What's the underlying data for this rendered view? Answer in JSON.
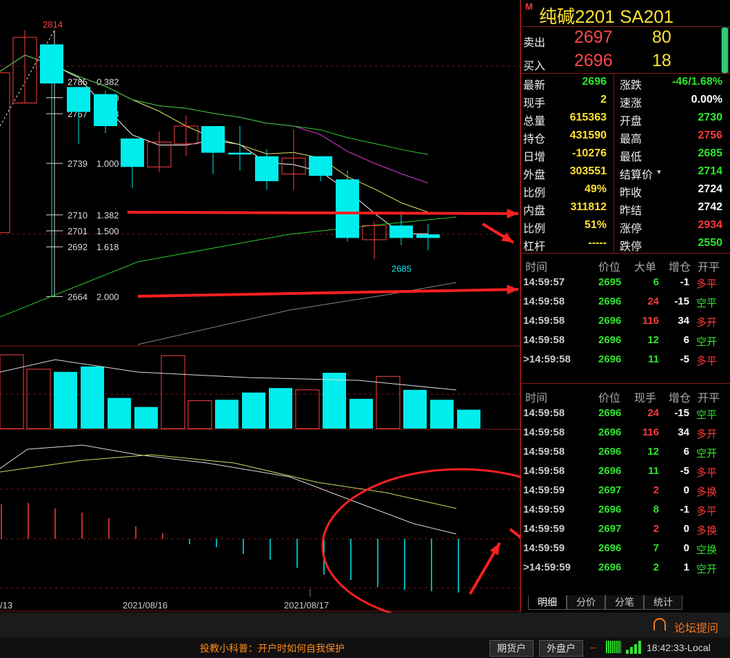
{
  "chart_data": {
    "type": "candlestick",
    "candles": [
      {
        "o": 2700,
        "h": 2792,
        "l": 2700,
        "c": 2790
      },
      {
        "o": 2773,
        "h": 2814,
        "l": 2773,
        "c": 2810
      },
      {
        "o": 2806,
        "h": 2806,
        "l": 2664,
        "c": 2784
      },
      {
        "o": 2782,
        "h": 2782,
        "l": 2750,
        "c": 2768
      },
      {
        "o": 2778,
        "h": 2780,
        "l": 2756,
        "c": 2760
      },
      {
        "o": 2753,
        "h": 2753,
        "l": 2725,
        "c": 2737
      },
      {
        "o": 2737,
        "h": 2757,
        "l": 2734,
        "c": 2751
      },
      {
        "o": 2750,
        "h": 2766,
        "l": 2743,
        "c": 2760
      },
      {
        "o": 2760,
        "h": 2760,
        "l": 2733,
        "c": 2745
      },
      {
        "o": 2745,
        "h": 2760,
        "l": 2735,
        "c": 2744
      },
      {
        "o": 2743,
        "h": 2747,
        "l": 2724,
        "c": 2729
      },
      {
        "o": 2733,
        "h": 2758,
        "l": 2724,
        "c": 2742
      },
      {
        "o": 2743,
        "h": 2743,
        "l": 2729,
        "c": 2732
      },
      {
        "o": 2730,
        "h": 2735,
        "l": 2695,
        "c": 2697
      },
      {
        "o": 2696,
        "h": 2706,
        "l": 2685,
        "c": 2704
      },
      {
        "o": 2704,
        "h": 2712,
        "l": 2693,
        "c": 2697
      },
      {
        "o": 2699,
        "h": 2705,
        "l": 2690,
        "c": 2697
      }
    ],
    "ylim": [
      2637,
      2831
    ],
    "price_labels": {
      "high": "2814",
      "low": "2685"
    },
    "fib_levels": [
      {
        "price": "2785",
        "ratio": "0.382"
      },
      {
        "price": "2776",
        "ratio": "0.500"
      },
      {
        "price": "2767",
        "ratio": "0.618"
      },
      {
        "price": "2739",
        "ratio": "1.000"
      },
      {
        "price": "2710",
        "ratio": "1.382"
      },
      {
        "price": "2701",
        "ratio": "1.500"
      },
      {
        "price": "2692",
        "ratio": "1.618"
      },
      {
        "price": "2664",
        "ratio": "2.000"
      }
    ],
    "volume": [
      82,
      66,
      63,
      69,
      34,
      24,
      81,
      31,
      32,
      40,
      45,
      43,
      62,
      33,
      58,
      43,
      32,
      21
    ],
    "dates": [
      "/13",
      "2021/08/16",
      "2021/08/17"
    ]
  },
  "quote": {
    "m": "M",
    "title": "纯碱2201  SA201",
    "sell_label": "卖出",
    "sell_price": "2697",
    "sell_vol": "80",
    "buy_label": "买入",
    "buy_price": "2696",
    "buy_vol": "18",
    "stats": [
      {
        "l1": "最新",
        "v1": "2696",
        "c1": "grn",
        "l2": "涨跌",
        "v2": "-46/1.68%",
        "c2": "grn"
      },
      {
        "l1": "现手",
        "v1": "2",
        "c1": "yel",
        "l2": "速涨",
        "v2": "0.00%",
        "c2": "wht"
      },
      {
        "l1": "总量",
        "v1": "615363",
        "c1": "yel",
        "l2": "开盘",
        "v2": "2730",
        "c2": "grn"
      },
      {
        "l1": "持仓",
        "v1": "431590",
        "c1": "yel",
        "l2": "最高",
        "v2": "2756",
        "c2": "red"
      },
      {
        "l1": "日增",
        "v1": "-10276",
        "c1": "yel",
        "l2": "最低",
        "v2": "2685",
        "c2": "grn"
      },
      {
        "l1": "外盘",
        "v1": "303551",
        "c1": "yel",
        "l2": "结算价",
        "v2": "2714",
        "c2": "grn"
      },
      {
        "l1": "比例",
        "v1": "49%",
        "c1": "yel",
        "l2": "昨收",
        "v2": "2724",
        "c2": "wht"
      },
      {
        "l1": "内盘",
        "v1": "311812",
        "c1": "yel",
        "l2": "昨结",
        "v2": "2742",
        "c2": "wht"
      },
      {
        "l1": "比例",
        "v1": "51%",
        "c1": "yel",
        "l2": "涨停",
        "v2": "2934",
        "c2": "red"
      },
      {
        "l1": "杠杆",
        "v1": "-----",
        "c1": "yel",
        "l2": "跌停",
        "v2": "2550",
        "c2": "grn"
      }
    ]
  },
  "ticks_big": {
    "headers": [
      "时间",
      "价位",
      "大单",
      "增仓",
      "开平"
    ],
    "rows": [
      {
        "t": "14:59:57",
        "p": "2695",
        "v": "6",
        "vc": "grn",
        "d": "-1",
        "k": "多平",
        "kc": "red"
      },
      {
        "t": "14:59:58",
        "p": "2696",
        "v": "24",
        "vc": "red",
        "d": "-15",
        "k": "空平",
        "kc": "grn"
      },
      {
        "t": "14:59:58",
        "p": "2696",
        "v": "116",
        "vc": "red",
        "d": "34",
        "k": "多开",
        "kc": "red"
      },
      {
        "t": "14:59:58",
        "p": "2696",
        "v": "12",
        "vc": "grn",
        "d": "6",
        "k": "空开",
        "kc": "grn"
      },
      {
        "t": ">14:59:58",
        "p": "2696",
        "v": "11",
        "vc": "grn",
        "d": "-5",
        "k": "多平",
        "kc": "red"
      }
    ]
  },
  "ticks": {
    "headers": [
      "时间",
      "价位",
      "现手",
      "增仓",
      "开平"
    ],
    "rows": [
      {
        "t": "14:59:58",
        "p": "2696",
        "v": "24",
        "vc": "red",
        "d": "-15",
        "k": "空平",
        "kc": "grn"
      },
      {
        "t": "14:59:58",
        "p": "2696",
        "v": "116",
        "vc": "red",
        "d": "34",
        "k": "多开",
        "kc": "red"
      },
      {
        "t": "14:59:58",
        "p": "2696",
        "v": "12",
        "vc": "grn",
        "d": "6",
        "k": "空开",
        "kc": "grn"
      },
      {
        "t": "14:59:58",
        "p": "2696",
        "v": "11",
        "vc": "grn",
        "d": "-5",
        "k": "多平",
        "kc": "red"
      },
      {
        "t": "14:59:59",
        "p": "2697",
        "v": "2",
        "vc": "red",
        "d": "0",
        "k": "多换",
        "kc": "red"
      },
      {
        "t": "14:59:59",
        "p": "2696",
        "v": "8",
        "vc": "grn",
        "d": "-1",
        "k": "多平",
        "kc": "red"
      },
      {
        "t": "14:59:59",
        "p": "2697",
        "v": "2",
        "vc": "red",
        "d": "0",
        "k": "多换",
        "kc": "red"
      },
      {
        "t": "14:59:59",
        "p": "2696",
        "v": "7",
        "vc": "grn",
        "d": "0",
        "k": "空换",
        "kc": "grn"
      },
      {
        "t": ">14:59:59",
        "p": "2696",
        "v": "2",
        "vc": "grn",
        "d": "1",
        "k": "空开",
        "kc": "grn"
      }
    ]
  },
  "tabs": [
    "明细",
    "分价",
    "分笔",
    "统计"
  ],
  "footer": {
    "forum": "论坛提问",
    "tip": "投教小科普：开户时如何自我保护",
    "btn1": "期货户",
    "btn2": "外盘户",
    "clock": "18:42:33-Local"
  }
}
